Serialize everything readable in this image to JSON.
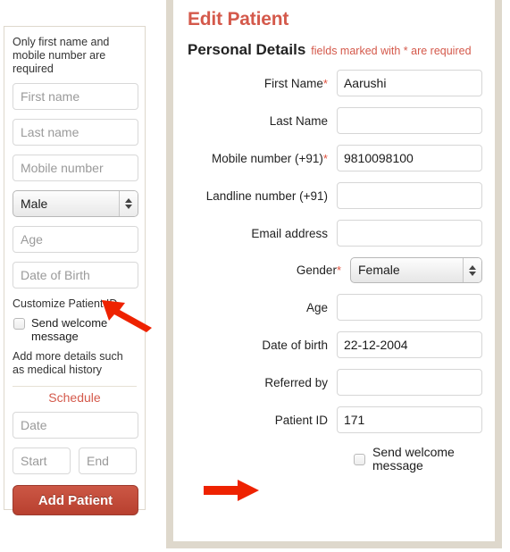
{
  "left_panel": {
    "hint": "Only first name and mobile number are required",
    "fields": [
      {
        "name": "first-name",
        "placeholder": "First name"
      },
      {
        "name": "last-name",
        "placeholder": "Last name"
      },
      {
        "name": "mobile-number",
        "placeholder": "Mobile number"
      }
    ],
    "gender_select": {
      "value": "Male"
    },
    "fields2": [
      {
        "name": "age",
        "placeholder": "Age"
      },
      {
        "name": "date-of-birth",
        "placeholder": "Date of Birth"
      }
    ],
    "customize_patient_id_link": "Customize Patient ID",
    "send_welcome_message_label": "Send welcome message",
    "add_more_details_link": "Add more details such as medical history",
    "schedule_title": "Schedule",
    "date_placeholder": "Date",
    "start_placeholder": "Start",
    "end_placeholder": "End",
    "add_patient_button": "Add Patient"
  },
  "right_panel": {
    "title": "Edit Patient",
    "section_title": "Personal Details",
    "section_note": "fields marked with * are required",
    "rows": [
      {
        "name": "first-name",
        "label": "First Name",
        "required": true,
        "value": "Aarushi",
        "type": "text"
      },
      {
        "name": "last-name",
        "label": "Last Name",
        "required": false,
        "value": "",
        "type": "text"
      },
      {
        "name": "mobile-number",
        "label": "Mobile number (+91)",
        "required": true,
        "value": "9810098100",
        "type": "text"
      },
      {
        "name": "landline-number",
        "label": "Landline number (+91)",
        "required": false,
        "value": "",
        "type": "text"
      },
      {
        "name": "email-address",
        "label": "Email address",
        "required": false,
        "value": "",
        "type": "text"
      },
      {
        "name": "gender",
        "label": "Gender",
        "required": true,
        "value": "Female",
        "type": "select"
      },
      {
        "name": "age",
        "label": "Age",
        "required": false,
        "value": "",
        "type": "text"
      },
      {
        "name": "date-of-birth",
        "label": "Date of birth",
        "required": false,
        "value": "22-12-2004",
        "type": "text"
      },
      {
        "name": "referred-by",
        "label": "Referred by",
        "required": false,
        "value": "",
        "type": "text"
      },
      {
        "name": "patient-id",
        "label": "Patient ID",
        "required": false,
        "value": "171",
        "type": "text"
      }
    ],
    "send_welcome_message_label": "Send welcome message"
  },
  "annotations": {
    "arrow_1": "arrow-pointing-to-customize-patient-id",
    "arrow_2": "arrow-pointing-to-patient-id",
    "arrow_color": "#ee2200"
  },
  "colors": {
    "accent_red": "#d4594b",
    "button_red": "#c14e3c",
    "panel_border": "#ded8cc",
    "arrow_red": "#ee2200"
  }
}
